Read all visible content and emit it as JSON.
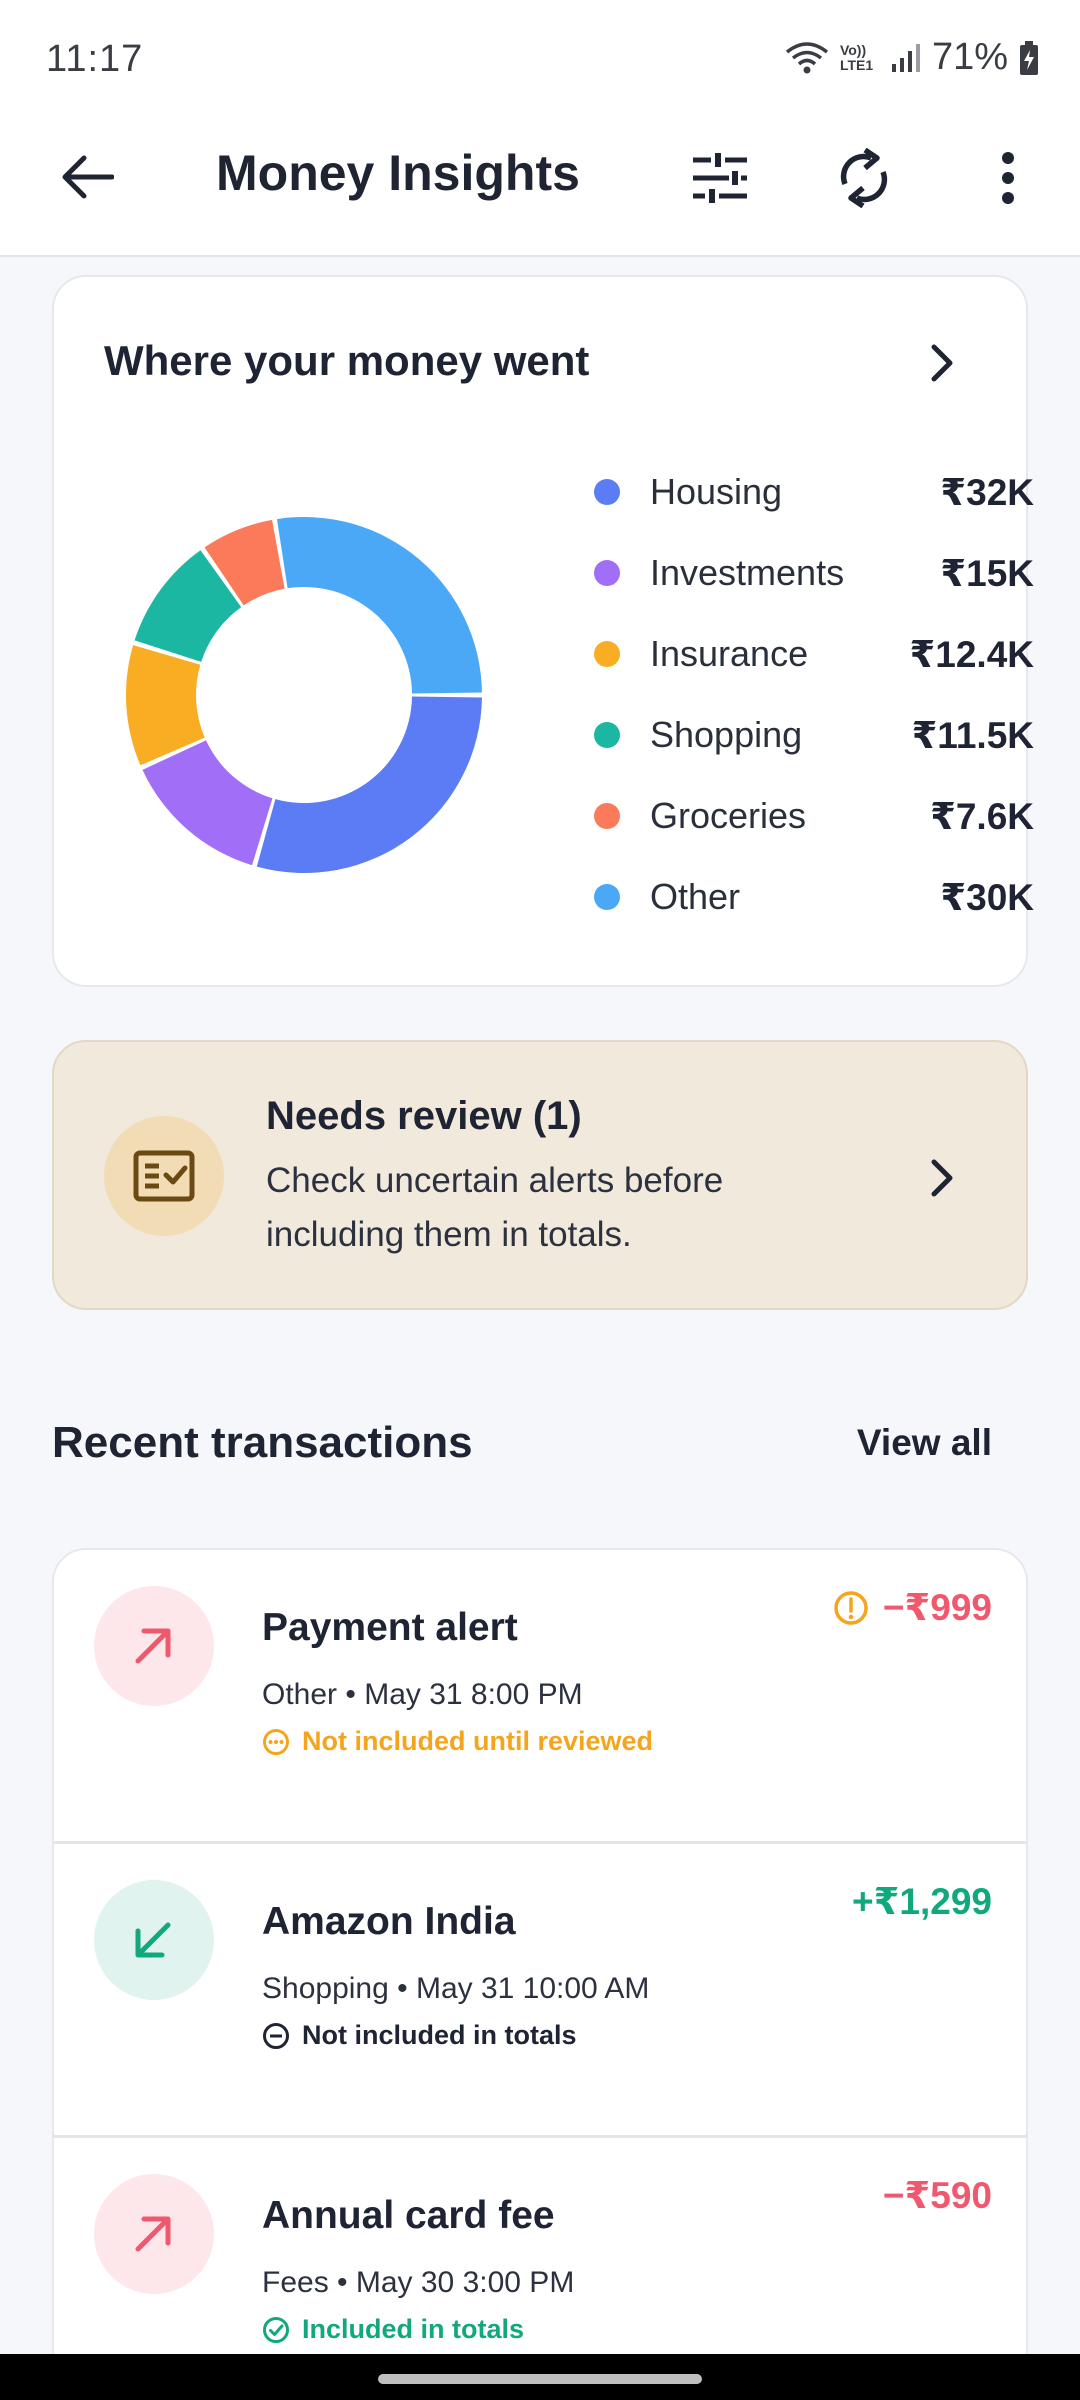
{
  "status": {
    "time": "11:17",
    "network": "Vo)) LTE1",
    "battery": "71%"
  },
  "header": {
    "title": "Money Insights"
  },
  "spending": {
    "title": "Where your money went",
    "chart_data": {
      "type": "pie",
      "categories": [
        "Housing",
        "Investments",
        "Insurance",
        "Shopping",
        "Groceries",
        "Other"
      ],
      "values": [
        32,
        15,
        12.4,
        11.5,
        7.6,
        30
      ],
      "value_labels": [
        "₹32K",
        "₹15K",
        "₹12.4K",
        "₹11.5K",
        "₹7.6K",
        "₹30K"
      ],
      "colors": [
        "#5b7cf5",
        "#a06ef7",
        "#f9ad22",
        "#1cb7a2",
        "#fa7a5a",
        "#4aa8f7"
      ],
      "donut": true,
      "legend": "right"
    }
  },
  "review": {
    "title": "Needs review (1)",
    "description": "Check uncertain alerts before including them in totals."
  },
  "recent": {
    "title": "Recent transactions",
    "view_all": "View all",
    "items": [
      {
        "name": "Payment alert",
        "meta": "Other • May 31 8:00 PM",
        "status": "Not included until reviewed",
        "amount": "−₹999",
        "direction": "out",
        "status_kind": "pending",
        "amount_color": "#f0586e",
        "status_color": "#f5a51d"
      },
      {
        "name": "Amazon India",
        "meta": "Shopping • May 31 10:00 AM",
        "status": "Not included in totals",
        "amount": "+₹1,299",
        "direction": "in",
        "status_kind": "excluded",
        "amount_color": "#11a87e",
        "status_color": "#1e2433"
      },
      {
        "name": "Annual card fee",
        "meta": "Fees • May 30 3:00 PM",
        "status": "Included in totals",
        "amount": "−₹590",
        "direction": "out",
        "status_kind": "included",
        "amount_color": "#f0586e",
        "status_color": "#11a87e"
      }
    ]
  }
}
